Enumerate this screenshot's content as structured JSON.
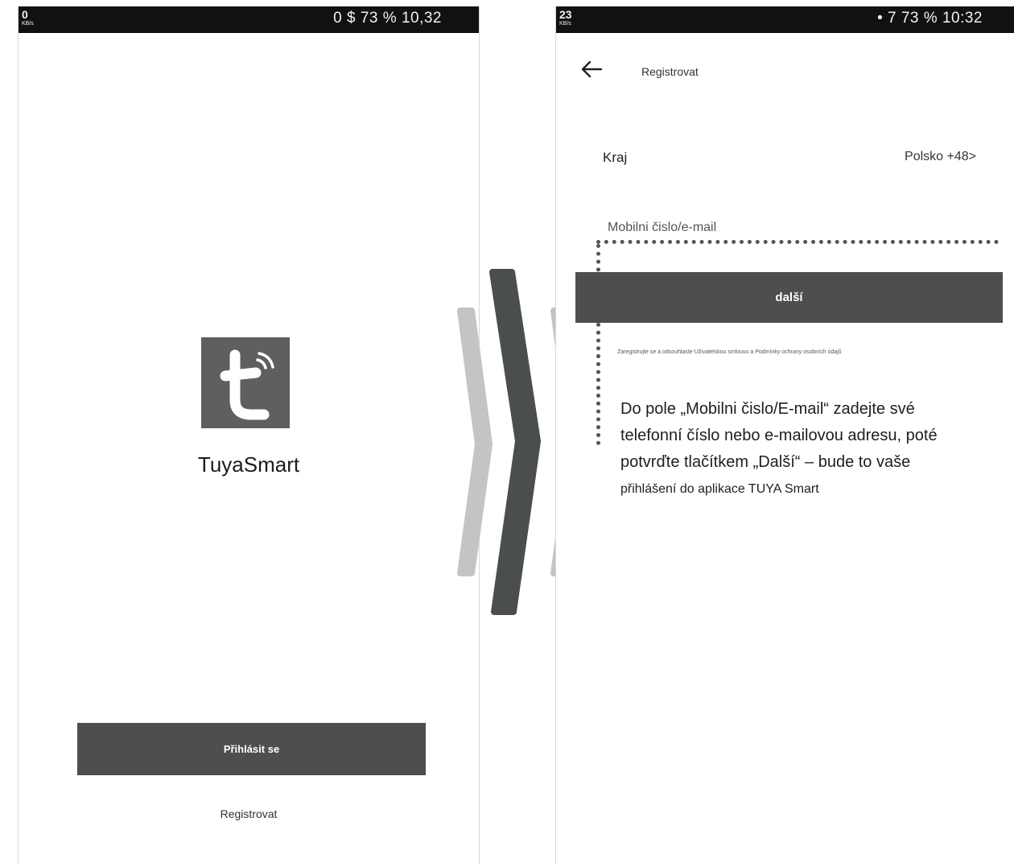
{
  "left_screen": {
    "status_bar": {
      "left": "0",
      "left_sub": "KB/s",
      "right": "0 $ 73 % 10,32"
    },
    "app_name": "TuyaSmart",
    "login_button": "Přihlásit se",
    "register_link": "Registrovat"
  },
  "right_screen": {
    "status_bar": {
      "left": "23",
      "left_sub": "KB/s",
      "right": "• 7 73 % 10:32"
    },
    "title": "Registrovat",
    "region": {
      "label": "Kraj",
      "value": "Polsko +48>"
    },
    "input": {
      "placeholder": "Mobilni čislo/e-mail"
    },
    "next_button": "další",
    "terms": "Zaregistrujte se a odsouhlaste Uživatelskou smlouvu a Podmínky ochrany osobních údajů",
    "instructions": [
      "Do pole „Mobilni čislo/E-mail“ zadejte své",
      "telefonní číslo nebo e-mailovou adresu, poté",
      "potvrďte tlačítkem „Další“ – bude to vaše",
      "přihlášení do aplikace TUYA Smart"
    ]
  },
  "colors": {
    "button": "#4c4f4c",
    "status_bar": "#111111",
    "logo_bg": "#5d605e",
    "chevron_light": "#bdbdbd",
    "chevron_dark": "#4b4f4b"
  }
}
